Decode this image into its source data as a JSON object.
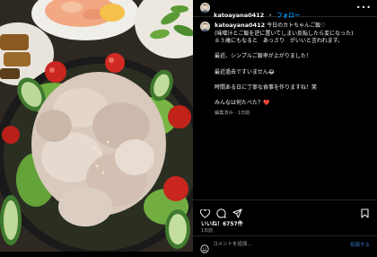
{
  "post": {
    "username": "katoayana0412",
    "follow_label": "フォロー",
    "separator": "•",
    "more_icon": "more-dots-icon"
  },
  "caption": {
    "username": "katoayana0412",
    "lines": [
      "今日のカトちゃんご飯♡",
      "(味噌汁とご飯を逆に置いてしまい反転したら変になった)",
      "８３歳にもなると　あっさり　がいいと言われます。",
      "",
      "最近、シンプルご飯率が上がりました！",
      "",
      "最近過去ですいません😂",
      "",
      "時間ある日に丁寧な食事を作りますね！笑",
      "",
      "みんなは何たべた？❤️"
    ],
    "meta": "編集済み · 1日前"
  },
  "actions": {
    "like_icon": "heart-icon",
    "comment_icon": "comment-icon",
    "share_icon": "share-icon",
    "save_icon": "bookmark-icon"
  },
  "likes": "いいね！6757件",
  "date": "1日前",
  "comment": {
    "placeholder": "コメントを追加...",
    "post_label": "投稿する",
    "emoji_icon": "emoji-icon"
  },
  "colors": {
    "background": "#000000",
    "accent": "#0095f6",
    "text": "#f5f5f5",
    "muted": "#a8a8a8"
  }
}
